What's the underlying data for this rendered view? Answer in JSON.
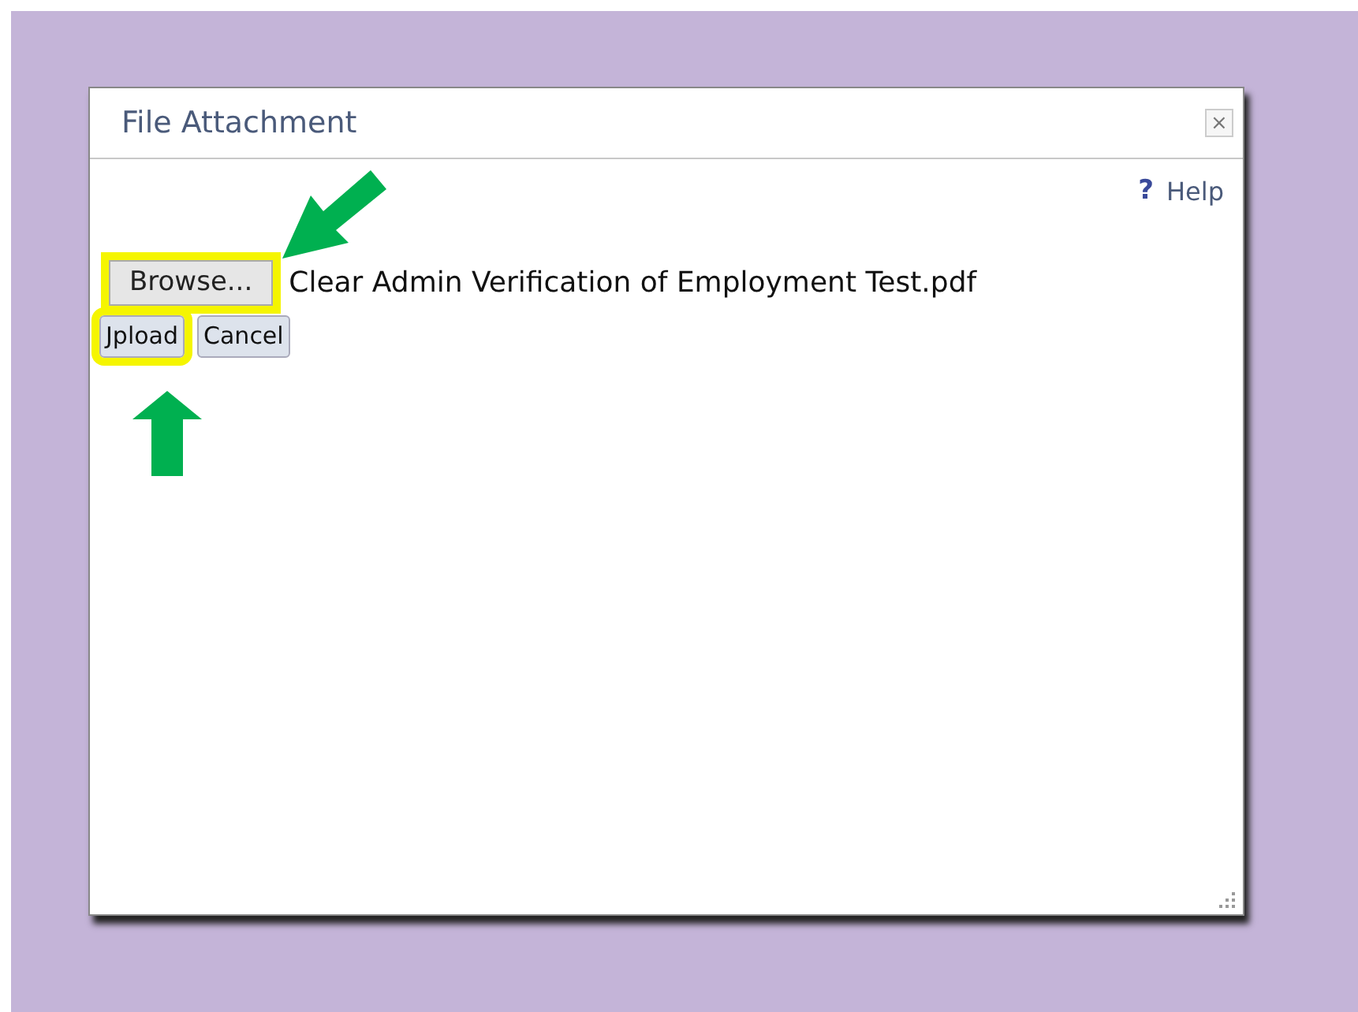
{
  "dialog": {
    "title": "File Attachment",
    "close": "×",
    "help": {
      "icon": "?",
      "label": "Help"
    },
    "file": {
      "browse": "Browse...",
      "filename": "Clear Admin Verification of Employment Test.pdf"
    },
    "buttons": [
      {
        "label": "Jpload",
        "highlighted": true
      },
      {
        "label": "Cancel",
        "highlighted": false
      }
    ]
  }
}
